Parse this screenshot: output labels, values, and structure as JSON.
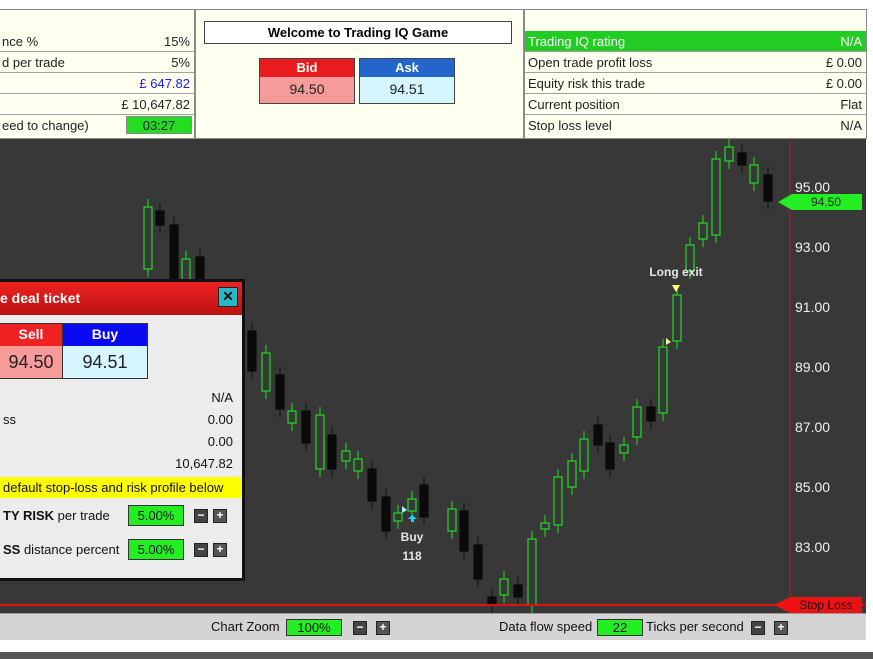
{
  "left_panel": {
    "rows": [
      {
        "label": "nce %",
        "value": "15%"
      },
      {
        "label": "d per trade",
        "value": "5%"
      },
      {
        "label": "",
        "value": "£ 647.82",
        "value_color": "#1a1aee"
      },
      {
        "label": "",
        "value": "£ 10,647.82"
      },
      {
        "label": "eed to change)",
        "value": "03:27"
      }
    ]
  },
  "center_panel": {
    "title": "Welcome to Trading IQ Game",
    "bid_label": "Bid",
    "bid_value": "94.50",
    "ask_label": "Ask",
    "ask_value": "94.51"
  },
  "right_panel": {
    "rows": [
      {
        "label": "Trading IQ rating",
        "value": "N/A"
      },
      {
        "label": "Open trade profit loss",
        "value": "£ 0.00"
      },
      {
        "label": "Equity risk this trade",
        "value": "£ 0.00"
      },
      {
        "label": "Current position",
        "value": "Flat"
      },
      {
        "label": "Stop loss level",
        "value": "N/A"
      }
    ]
  },
  "chart_data": {
    "type": "candlestick",
    "y_ticks": [
      "95.00",
      "93.00",
      "91.00",
      "89.00",
      "87.00",
      "85.00",
      "83.00"
    ],
    "y_tick_values": [
      95,
      93,
      91,
      89,
      87,
      85,
      83
    ],
    "current_price_label": "94.50",
    "stop_loss_label": "Stop Loss",
    "annotations": {
      "buy_label": "Buy",
      "buy_qty": "118",
      "long_exit_label": "Long exit"
    },
    "colors": {
      "up": "#22dd22",
      "down": "#111111",
      "background": "#383838",
      "stop_line": "#dd1111",
      "price_tag": "#22ee22"
    }
  },
  "deal_ticket": {
    "title": "e deal ticket",
    "close_label": "✕",
    "sell_label": "Sell",
    "sell_value": "94.50",
    "buy_label": "Buy",
    "buy_value": "94.51",
    "values": [
      "N/A",
      "0.00",
      "0.00",
      "10,647.82"
    ],
    "loss_label": "ss",
    "default_note": "default stop-loss and risk profile below",
    "equity_risk_bold": "TY RISK",
    "equity_risk_rest": " per trade",
    "equity_risk_value": "5.00%",
    "stop_distance_bold": "SS",
    "stop_distance_rest": " distance percent",
    "stop_distance_value": "5.00%"
  },
  "bottom_bar": {
    "zoom_label": "Chart Zoom",
    "zoom_value": "100%",
    "speed_label": "Data flow speed",
    "speed_value": "22",
    "ticks_label": "Ticks per second"
  }
}
